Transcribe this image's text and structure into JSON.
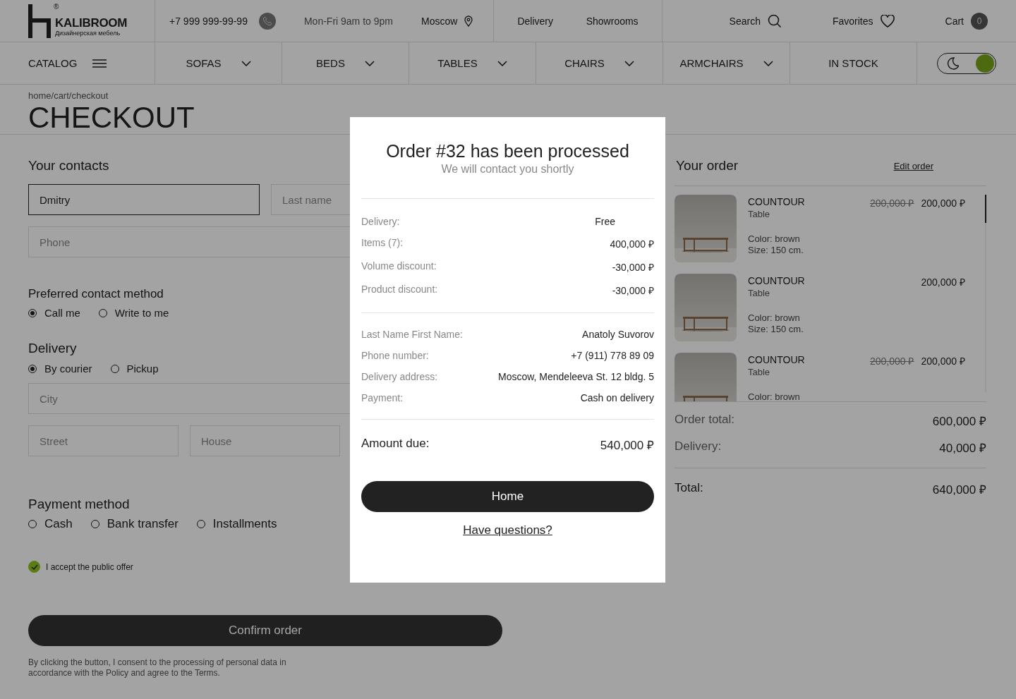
{
  "header": {
    "logo": {
      "registered": "®",
      "name": "KALIBROOM",
      "tagline": "Дизайнерская мебель"
    },
    "phone": "+7 999 999-99-99",
    "hours": "Mon-Fri 9am to 9pm",
    "city": "Moscow",
    "links": [
      "Delivery",
      "Showrooms"
    ],
    "search": "Search",
    "favorites": "Favorites",
    "cart": {
      "label": "Cart",
      "count": "0"
    }
  },
  "nav": {
    "catalog": "CATALOG",
    "items": [
      {
        "label": "SOFAS",
        "dropdown": true
      },
      {
        "label": "BEDS",
        "dropdown": true
      },
      {
        "label": "TABLES",
        "dropdown": true
      },
      {
        "label": "CHAIRS",
        "dropdown": true
      },
      {
        "label": "ARMCHAIRS",
        "dropdown": true
      },
      {
        "label": "IN STOCK",
        "dropdown": false
      }
    ],
    "theme_toggle": {
      "on": true
    }
  },
  "breadcrumb": "home/cart/checkout",
  "title": "CHECKOUT",
  "contacts": {
    "heading": "Your contacts",
    "fields": [
      {
        "value": "Dmitry",
        "focused": true
      },
      {
        "placeholder": "Last name",
        "focused": false
      },
      {
        "placeholder": "Phone",
        "focused": false
      }
    ]
  },
  "contact_method": {
    "heading": "Preferred contact method",
    "options": [
      {
        "label": "Call me",
        "selected": true
      },
      {
        "label": "Write to me",
        "selected": false
      }
    ]
  },
  "delivery": {
    "heading": "Delivery",
    "options": [
      {
        "label": "By courier",
        "selected": true
      },
      {
        "label": "Pickup",
        "selected": false
      }
    ],
    "fields": [
      {
        "placeholder": "City",
        "focused": false
      },
      {
        "placeholder": "Street",
        "focused": false
      },
      {
        "placeholder": "House",
        "focused": false
      }
    ]
  },
  "payment": {
    "heading": "Payment method",
    "options": [
      {
        "label": "Cash",
        "selected": false
      },
      {
        "label": "Bank transfer",
        "selected": false
      },
      {
        "label": "Installments",
        "selected": false
      }
    ]
  },
  "offer": {
    "label": "I accept the public offer",
    "checked": true
  },
  "confirm_button": "Confirm order",
  "consent": "By clicking the button, I consent to the processing of personal data in accordance with the Policy and agree to the Terms.",
  "order": {
    "heading": "Your order",
    "edit": "Edit order",
    "items": [
      {
        "name": "COUNTOUR",
        "type": "Table",
        "old_price": "200,000 ₽",
        "price": "200,000 ₽",
        "finish": "Color: brown",
        "size": "Size: 150 cm."
      },
      {
        "name": "COUNTOUR",
        "type": "Table",
        "price": "200,000 ₽",
        "finish": "Color: brown",
        "size": "Size: 150 cm."
      },
      {
        "name": "COUNTOUR",
        "type": "Table",
        "old_price": "200,000 ₽",
        "price": "200,000 ₽",
        "finish": "Color: brown"
      }
    ],
    "summary": [
      {
        "label": "Order total:",
        "value": "600,000 ₽"
      },
      {
        "label": "Delivery:",
        "value": "40,000 ₽"
      }
    ],
    "total": {
      "label": "Total:",
      "value": "640,000 ₽"
    }
  },
  "modal": {
    "title": "Order #32 has been processed",
    "subtitle": "We will contact you shortly",
    "costs": [
      {
        "label": "Delivery:",
        "value": "Free"
      },
      {
        "label": "Items (7):",
        "value": "400,000 ₽"
      },
      {
        "label": "Volume discount:",
        "value": "-30,000 ₽"
      },
      {
        "label": "Product discount:",
        "value": "-30,000 ₽"
      }
    ],
    "details": [
      {
        "label": "Last Name First Name:",
        "value": "Anatoly Suvorov"
      },
      {
        "label": "Phone number:",
        "value": "+7 (911) 778 89 09"
      },
      {
        "label": "Delivery address:",
        "value": "Moscow, Mendeleeva St. 12 bldg. 5"
      },
      {
        "label": "Payment:",
        "value": "Cash on delivery"
      }
    ],
    "amount_due": {
      "label": "Amount due:",
      "value": "540,000 ₽"
    },
    "home_button": "Home",
    "questions_link": "Have questions?"
  }
}
